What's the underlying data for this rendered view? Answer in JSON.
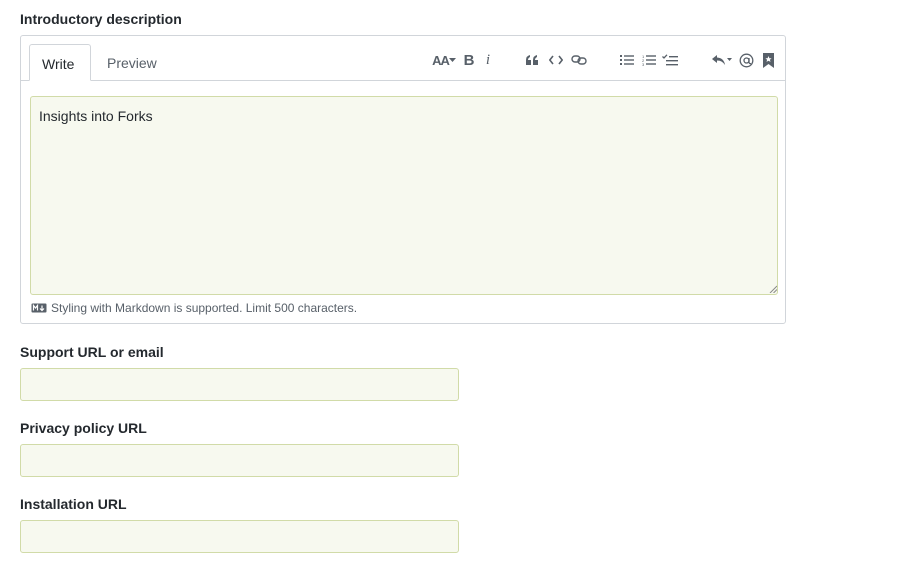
{
  "description": {
    "label": "Introductory description",
    "tabs": {
      "write": "Write",
      "preview": "Preview"
    },
    "toolbar": {
      "heading": "AA",
      "bold": "B",
      "italic": "i"
    },
    "value": "Insights into Forks",
    "hint": "Styling with Markdown is supported. Limit 500 characters."
  },
  "support": {
    "label": "Support URL or email",
    "value": ""
  },
  "privacy": {
    "label": "Privacy policy URL",
    "value": ""
  },
  "installation": {
    "label": "Installation URL",
    "value": ""
  },
  "colors": {
    "input_bg": "#f7f9ef",
    "input_border": "#d1dba8",
    "text": "#24292e",
    "muted": "#586069"
  },
  "icons": [
    "heading-icon",
    "bold-icon",
    "italic-icon",
    "quote-icon",
    "code-icon",
    "link-icon",
    "unordered-list-icon",
    "ordered-list-icon",
    "task-list-icon",
    "reply-icon",
    "mention-icon",
    "bookmark-icon",
    "markdown-icon"
  ]
}
